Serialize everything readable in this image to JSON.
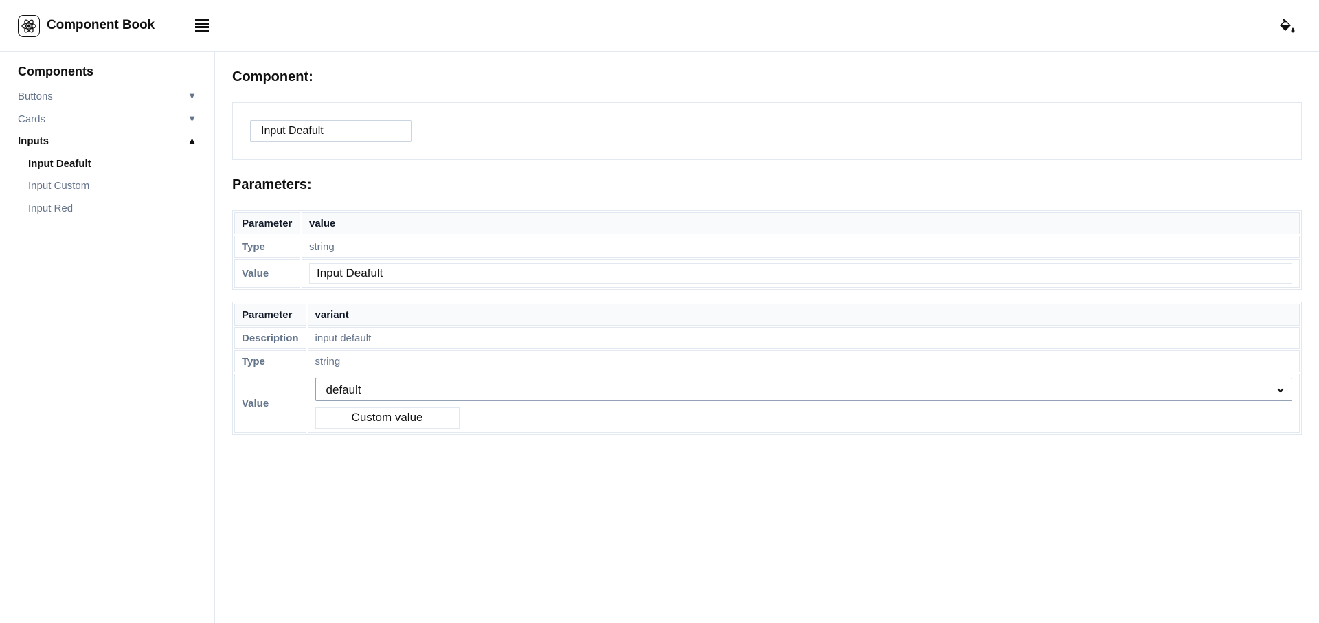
{
  "header": {
    "app_title": "Component Book",
    "logo_icon": "react-atom-icon",
    "menu_icon": "hamburger-menu-icon",
    "theme_icon": "paint-bucket-icon"
  },
  "sidebar": {
    "title": "Components",
    "groups": [
      {
        "label": "Buttons",
        "arrow": "▼",
        "expanded": false
      },
      {
        "label": "Cards",
        "arrow": "▼",
        "expanded": false
      },
      {
        "label": "Inputs",
        "arrow": "▲",
        "expanded": true,
        "items": [
          {
            "label": "Input Deafult",
            "active": true
          },
          {
            "label": "Input Custom",
            "active": false
          },
          {
            "label": "Input Red",
            "active": false
          }
        ]
      }
    ]
  },
  "main": {
    "component_heading": "Component:",
    "preview_input_value": "Input Deafult",
    "parameters_heading": "Parameters:",
    "tables": [
      {
        "parameter_label": "Parameter",
        "parameter_name": "value",
        "type_label": "Type",
        "type_value": "string",
        "value_label": "Value",
        "value_input": "Input Deafult"
      },
      {
        "parameter_label": "Parameter",
        "parameter_name": "variant",
        "description_label": "Description",
        "description_value": "input default",
        "type_label": "Type",
        "type_value": "string",
        "value_label": "Value",
        "select_value": "default",
        "custom_button_label": "Custom value"
      }
    ]
  }
}
